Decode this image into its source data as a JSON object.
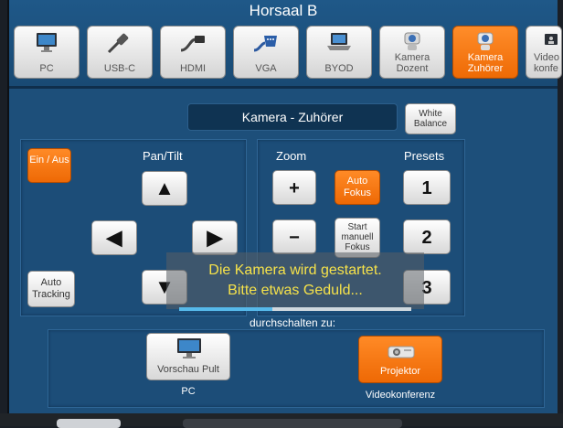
{
  "room_title": "Horsaal B",
  "sources": [
    {
      "label": "PC",
      "icon": "monitor-icon",
      "active": false
    },
    {
      "label": "USB-C",
      "icon": "usb-cable-icon",
      "active": false
    },
    {
      "label": "HDMI",
      "icon": "hdmi-cable-icon",
      "active": false
    },
    {
      "label": "VGA",
      "icon": "vga-cable-icon",
      "active": false
    },
    {
      "label": "BYOD",
      "icon": "laptop-icon",
      "active": false
    },
    {
      "label": "Kamera Dozent",
      "icon": "webcam-icon",
      "active": false
    },
    {
      "label": "Kamera Zuhörer",
      "icon": "webcam-icon",
      "active": true
    },
    {
      "label": "Video konfe",
      "icon": "video-conference-icon",
      "active": false
    }
  ],
  "camera": {
    "title": "Kamera - Zuhörer",
    "white_balance": "White Balance",
    "power": "Ein / Aus",
    "pan_tilt_label": "Pan/Tilt",
    "auto_tracking": "Auto Tracking",
    "zoom_label": "Zoom",
    "zoom_in": "+",
    "zoom_out": "−",
    "auto_focus": "Auto Fokus",
    "manual_focus": "Start manuell Fokus",
    "presets_label": "Presets",
    "presets": [
      "1",
      "2",
      "3"
    ]
  },
  "status": {
    "line1": "Die Kamera wird gestartet.",
    "line2": "Bitte etwas Geduld...",
    "progress": 0.4
  },
  "switch": {
    "label": "durchschalten zu:",
    "targets": [
      {
        "button": "Vorschau Pult",
        "caption": "PC",
        "icon": "monitor-icon",
        "active": false
      },
      {
        "button": "Projektor",
        "caption": "Videokonferenz",
        "icon": "projector-icon",
        "active": true
      }
    ]
  },
  "colors": {
    "accent": "#F07010",
    "background": "#1D4F7A",
    "status_text": "#F6E24A"
  }
}
